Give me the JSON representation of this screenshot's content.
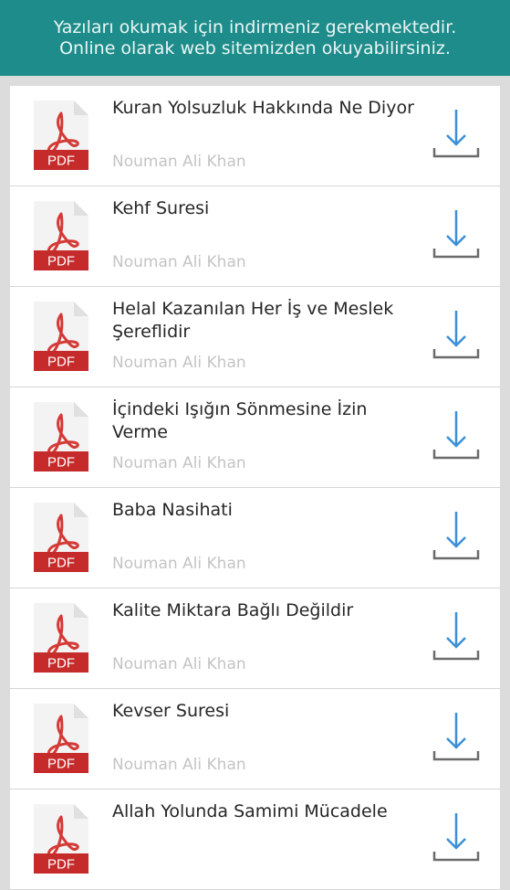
{
  "banner": {
    "line1": "Yazıları okumak için indirmeniz gerekmektedir.",
    "line2": "Online olarak web sitemizden okuyabilirsiniz."
  },
  "colors": {
    "banner": "#1e8c8a",
    "pdf_red": "#c62b2b",
    "acrobat_red": "#d33a36",
    "download_blue": "#3a8fd6",
    "tray_gray": "#6b6b6b"
  },
  "icons": {
    "file": "pdf-file-icon",
    "action": "download-icon"
  },
  "items": [
    {
      "title": "Kuran Yolsuzluk Hakkında Ne Diyor",
      "author": "Nouman Ali Khan",
      "badge": "PDF"
    },
    {
      "title": "Kehf Suresi",
      "author": "Nouman Ali Khan",
      "badge": "PDF"
    },
    {
      "title": "Helal Kazanılan Her İş ve Meslek Şereflidir",
      "author": "Nouman Ali Khan",
      "badge": "PDF"
    },
    {
      "title": "İçindeki Işığın Sönmesine İzin Verme",
      "author": "Nouman Ali Khan",
      "badge": "PDF"
    },
    {
      "title": "Baba Nasihati",
      "author": "Nouman Ali Khan",
      "badge": "PDF"
    },
    {
      "title": "Kalite Miktara Bağlı Değildir",
      "author": "Nouman Ali Khan",
      "badge": "PDF"
    },
    {
      "title": "Kevser Suresi",
      "author": "Nouman Ali Khan",
      "badge": "PDF"
    },
    {
      "title": "Allah Yolunda Samimi Mücadele",
      "author": "",
      "badge": "PDF"
    }
  ]
}
